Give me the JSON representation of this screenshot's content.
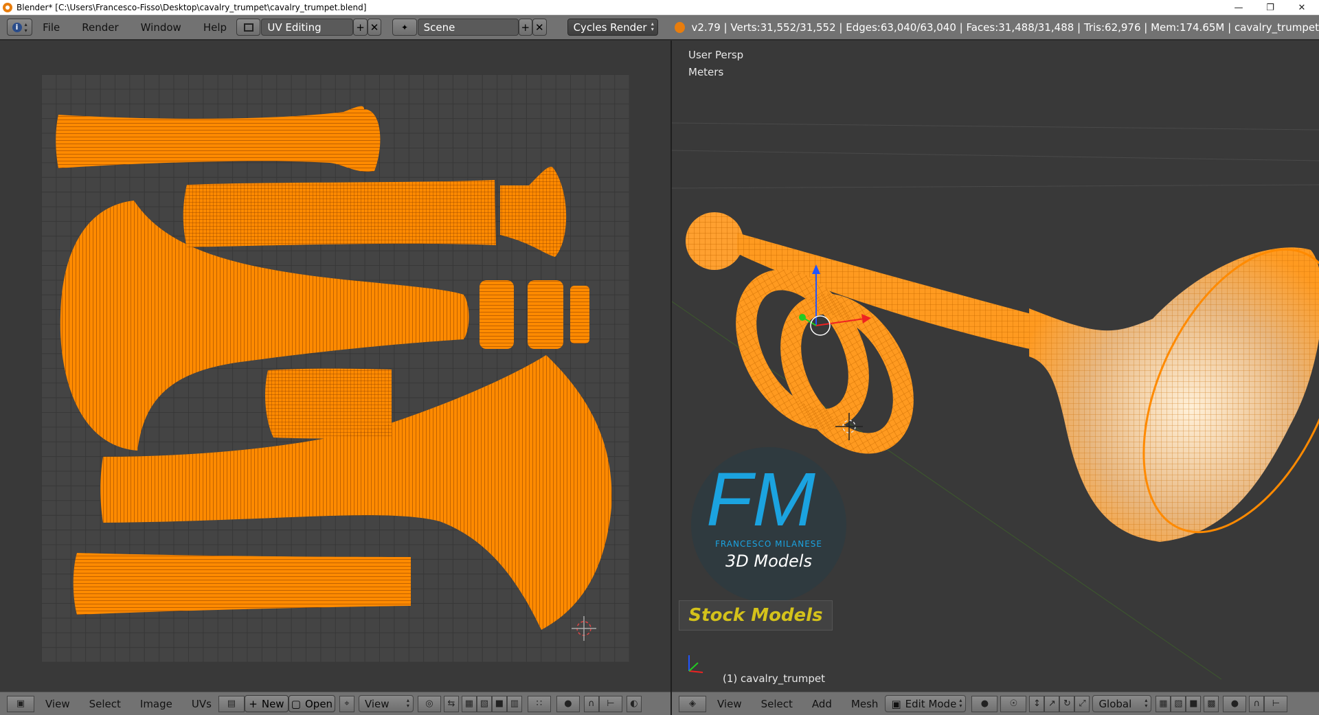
{
  "window": {
    "title": "Blender* [C:\\Users\\Francesco-Fisso\\Desktop\\cavalry_trumpet\\cavalry_trumpet.blend]",
    "minimize": "—",
    "restore": "❐",
    "close": "✕"
  },
  "info_header": {
    "menus": [
      "File",
      "Render",
      "Window",
      "Help"
    ],
    "layout": "UV Editing",
    "scene": "Scene",
    "engine": "Cycles Render",
    "stats": "v2.79 | Verts:31,552/31,552 | Edges:63,040/63,040 | Faces:31,488/31,488 | Tris:62,976 | Mem:174.65M | cavalry_trumpet"
  },
  "viewport": {
    "view_label": "User Persp",
    "units_label": "Meters",
    "object_label": "(1) cavalry_trumpet"
  },
  "watermark": {
    "logo": "FM",
    "name": "FRANCESCO MILANESE",
    "tagline": "3D Models",
    "stock": "Stock Models"
  },
  "uv_footer": {
    "menus": [
      "View",
      "Select",
      "Image",
      "UVs"
    ],
    "new": "New",
    "open": "Open",
    "view": "View"
  },
  "view3d_footer": {
    "menus": [
      "View",
      "Select",
      "Add",
      "Mesh"
    ],
    "mode": "Edit Mode",
    "orientation": "Global"
  },
  "colors": {
    "mesh": "#ff8a00",
    "wire": "#6a2c00",
    "background": "#393939",
    "header": "#727272"
  }
}
